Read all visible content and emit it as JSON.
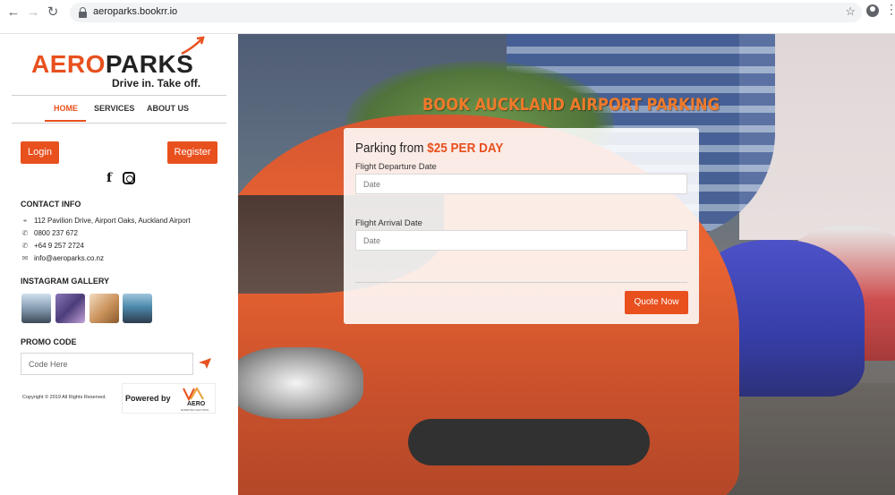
{
  "browser": {
    "url": "aeroparks.bookrr.io",
    "back_icon": "arrow-left-icon",
    "forward_icon": "arrow-right-icon",
    "reload_icon": "reload-icon",
    "star_icon": "star-icon",
    "kebab_glyph": "⋮"
  },
  "brand": {
    "logo_aero": "AERO",
    "logo_parks": "PARKS",
    "tagline": "Drive in. Take off.",
    "accent_color": "#e8501e"
  },
  "sidebar": {
    "menu": [
      {
        "label": "HOME",
        "active": true
      },
      {
        "label": "SERVICES",
        "active": false
      },
      {
        "label": "ABOUT US",
        "active": false
      }
    ],
    "login_label": "Login",
    "register_label": "Register",
    "social": [
      {
        "icon": "facebook-icon",
        "glyph": "f"
      },
      {
        "icon": "instagram-icon"
      }
    ],
    "contact_title": "CONTACT INFO",
    "contacts": [
      {
        "icon": "location-pin-icon",
        "text": "112 Pavilion Drive, Airport Oaks, Auckland Airport"
      },
      {
        "icon": "phone-icon",
        "text": "0800 237 672"
      },
      {
        "icon": "phone-icon",
        "text": "+64 9 257 2724"
      },
      {
        "icon": "mail-icon",
        "text": "info@aeroparks.co.nz"
      }
    ],
    "gallery_title": "INSTAGRAM GALLERY",
    "promo_title": "PROMO CODE",
    "promo_placeholder": "Code Here",
    "copyright": "Copyright © 2019 All Rights Reserved.",
    "powered_by": "Powered by",
    "powered_logo_text": "AERO",
    "powered_logo_sub": "MARKETING SOLUTIONS"
  },
  "hero": {
    "title": "BOOK AUCKLAND AIRPORT PARKING",
    "card": {
      "heading_prefix": "Parking from ",
      "heading_price": "$25 PER DAY",
      "departure_label": "Flight Departure Date",
      "departure_placeholder": "Date",
      "arrival_label": "Flight Arrival Date",
      "arrival_placeholder": "Date",
      "quote_label": "Quote Now"
    }
  }
}
